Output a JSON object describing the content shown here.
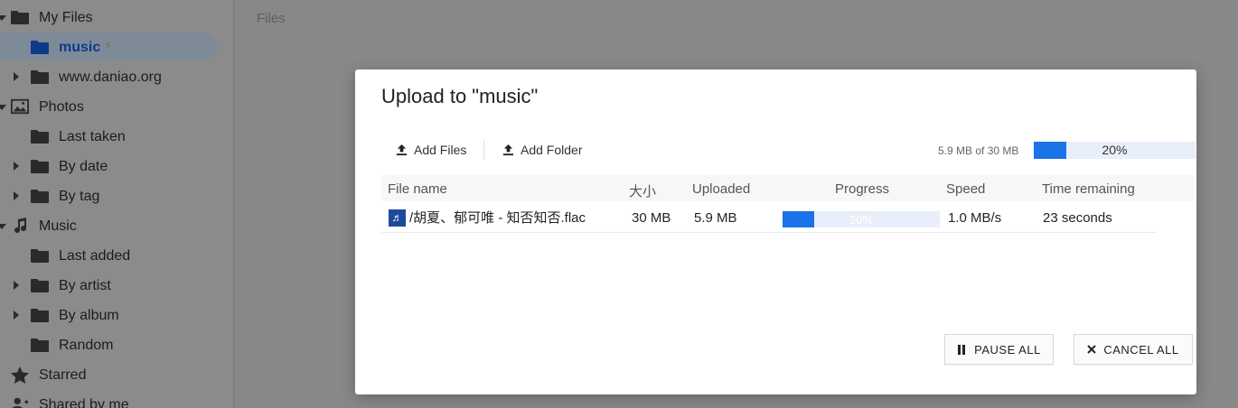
{
  "sidebar": {
    "items": [
      {
        "label": "My Files",
        "icon": "folder-icon",
        "caret": "down"
      },
      {
        "label": "music",
        "icon": "folder-icon",
        "caret": "",
        "selected": true,
        "badge_icon": "bolt-icon"
      },
      {
        "label": "www.daniao.org",
        "icon": "folder-icon",
        "caret": "right"
      },
      {
        "label": "Photos",
        "icon": "image-icon",
        "caret": "down"
      },
      {
        "label": "Last taken",
        "icon": "folder-icon",
        "caret": ""
      },
      {
        "label": "By date",
        "icon": "folder-icon",
        "caret": "right"
      },
      {
        "label": "By tag",
        "icon": "folder-icon",
        "caret": "right"
      },
      {
        "label": "Music",
        "icon": "music-note-icon",
        "caret": "down"
      },
      {
        "label": "Last added",
        "icon": "folder-icon",
        "caret": ""
      },
      {
        "label": "By artist",
        "icon": "folder-icon",
        "caret": "right"
      },
      {
        "label": "By album",
        "icon": "folder-icon",
        "caret": "right"
      },
      {
        "label": "Random",
        "icon": "folder-icon",
        "caret": ""
      },
      {
        "label": "Starred",
        "icon": "star-icon",
        "caret": ""
      },
      {
        "label": "Shared by me",
        "icon": "share-person-icon",
        "caret": ""
      }
    ]
  },
  "main": {
    "title": "Files"
  },
  "dialog": {
    "title": "Upload to \"music\"",
    "add_files_label": "Add Files",
    "add_folder_label": "Add Folder",
    "total_text": "5.9 MB of 30 MB",
    "total_progress": 0.2,
    "total_percent_label": "20%",
    "columns": {
      "name": "File name",
      "size": "大小",
      "uploaded": "Uploaded",
      "progress": "Progress",
      "speed": "Speed",
      "remaining": "Time remaining"
    },
    "rows": [
      {
        "icon": "audio-file-icon",
        "name": "/胡夏、郁可唯 - 知否知否.flac",
        "size": "30 MB",
        "uploaded": "5.9 MB",
        "progress": 0.2,
        "progress_label": "20%",
        "speed": "1.0 MB/s",
        "remaining": "23 seconds"
      }
    ],
    "pause_all_label": "PAUSE ALL",
    "cancel_all_label": "CANCEL ALL"
  },
  "colors": {
    "accent": "#1a73e8",
    "progress_track": "#e8eefa",
    "overlay": "#888888"
  }
}
